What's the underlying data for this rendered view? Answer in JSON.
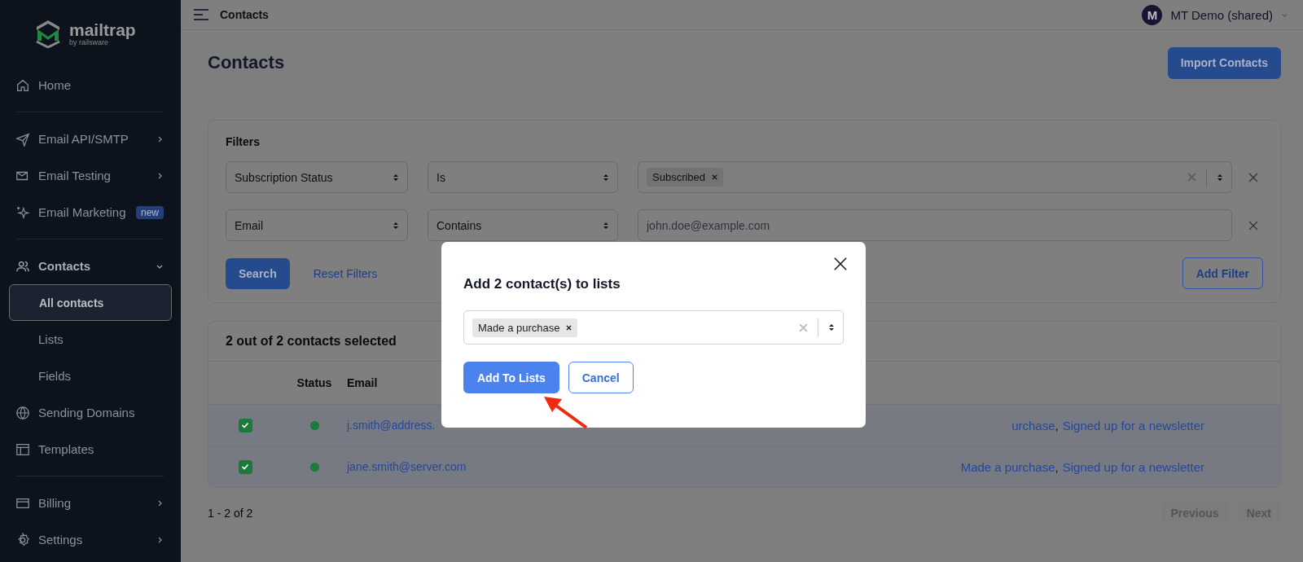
{
  "sidebar": {
    "logo": {
      "name": "mailtrap",
      "tagline": "by railsware"
    },
    "groups": [
      [
        {
          "label": "Home",
          "selected": false
        }
      ],
      [
        {
          "label": "Email API/SMTP",
          "selected": false,
          "expanded": false
        },
        {
          "label": "Email Testing",
          "selected": false,
          "expanded": false
        },
        {
          "label": "Email Marketing",
          "selected": false,
          "badge": "new"
        }
      ],
      [
        {
          "label": "Contacts",
          "selected": false,
          "expanded": true,
          "children": [
            {
              "label": "All contacts",
              "selected": true
            },
            {
              "label": "Lists",
              "selected": false
            },
            {
              "label": "Fields",
              "selected": false
            }
          ]
        },
        {
          "label": "Sending Domains",
          "selected": false
        },
        {
          "label": "Templates",
          "selected": false
        }
      ],
      [
        {
          "label": "Billing",
          "selected": false,
          "expanded": false
        },
        {
          "label": "Settings",
          "selected": false,
          "expanded": false
        }
      ]
    ]
  },
  "topbar": {
    "title": "Contacts",
    "account": {
      "initial": "M",
      "name": "MT Demo (shared)"
    }
  },
  "page": {
    "title": "Contacts",
    "import_button": "Import Contacts"
  },
  "filters": {
    "title": "Filters",
    "rows": [
      {
        "kind": "tags",
        "field": "Subscription Status",
        "operator": "Is",
        "tags": [
          "Subscribed"
        ]
      },
      {
        "kind": "text",
        "field": "Email",
        "operator": "Contains",
        "placeholder": "john.doe@example.com"
      }
    ],
    "search_button": "Search",
    "reset_link": "Reset Filters",
    "add_button": "Add Filter"
  },
  "table": {
    "selection": "2 out of 2 contacts selected",
    "columns": [
      "Status",
      "Email"
    ],
    "rows": [
      {
        "checked": true,
        "color": "#1c7a3c",
        "email": "j.smith@address.",
        "lists": [
          "urchase",
          "Signed up for a newsletter"
        ],
        "separator": ","
      },
      {
        "checked": true,
        "color": "#1c7a3c",
        "email": "jane.smith@server.com",
        "lists": [
          "Made a purchase",
          "Signed up for a newsletter"
        ],
        "separator": ","
      }
    ]
  },
  "pagination": {
    "summary": "1 - 2 of 2",
    "previous": {
      "label": "Previous",
      "disabled": true
    },
    "next": {
      "label": "Next",
      "disabled": true
    }
  },
  "modal": {
    "title": "Add 2 contact(s) to lists",
    "tags": [
      "Made a purchase"
    ],
    "confirm_button": "Add To Lists",
    "cancel_button": "Cancel"
  }
}
